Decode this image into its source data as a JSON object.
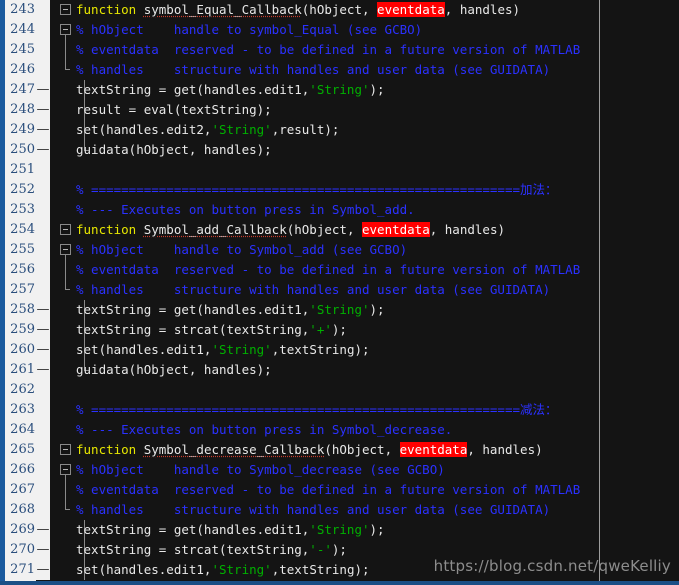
{
  "editor": {
    "title": "MATLAB Editor",
    "language": "MATLAB",
    "first_line": 243,
    "last_line": 271,
    "colors": {
      "background": "#141414",
      "gutter": "#f1f1f1",
      "linenumber": "#2b4f7d",
      "keyword": "#e7e700",
      "comment": "#2b31ff",
      "string": "#00b000",
      "plain": "#e8e8e8",
      "highlight": "#ff0000",
      "activity_strip": "#1a5a9e",
      "column_guide": "#9d9d9d"
    },
    "column_guide_column": 80
  },
  "watermark": {
    "text": "https://blog.csdn.net/qweKelliy"
  },
  "lines": [
    {
      "number": "243",
      "dash": "",
      "fold": "open",
      "bar": "none",
      "body": "none",
      "tokens": [
        {
          "t": "function ",
          "c": "kw"
        },
        {
          "t": "symbol_Equal_Callback",
          "c": "sq"
        },
        {
          "t": "(hObject, ",
          "c": "plain"
        },
        {
          "t": "eventdata",
          "c": "hl"
        },
        {
          "t": ", handles)",
          "c": "plain"
        }
      ]
    },
    {
      "number": "244",
      "dash": "",
      "fold": "open",
      "bar": "topstub",
      "body": "none",
      "tokens": [
        {
          "t": "% hObject    handle to symbol_Equal (see GCBO)",
          "c": "cmt"
        }
      ]
    },
    {
      "number": "245",
      "dash": "",
      "fold": "none",
      "bar": "full",
      "body": "none",
      "tokens": [
        {
          "t": "% eventdata  reserved - to be defined in a future version of MATLAB",
          "c": "cmt"
        }
      ]
    },
    {
      "number": "246",
      "dash": "",
      "fold": "none",
      "bar": "endtick",
      "body": "none",
      "tokens": [
        {
          "t": "% handles    structure with handles and user data (see GUIDATA)",
          "c": "cmt"
        }
      ]
    },
    {
      "number": "247",
      "dash": "—",
      "fold": "none",
      "bar": "none",
      "body": "full",
      "tokens": [
        {
          "t": "textString = get(handles.edit1,",
          "c": "plain"
        },
        {
          "t": "'String'",
          "c": "str"
        },
        {
          "t": ");",
          "c": "plain"
        }
      ]
    },
    {
      "number": "248",
      "dash": "—",
      "fold": "none",
      "bar": "none",
      "body": "full",
      "tokens": [
        {
          "t": "result = eval(textString);",
          "c": "plain"
        }
      ]
    },
    {
      "number": "249",
      "dash": "—",
      "fold": "none",
      "bar": "none",
      "body": "full",
      "tokens": [
        {
          "t": "set(handles.edit2,",
          "c": "plain"
        },
        {
          "t": "'String'",
          "c": "str"
        },
        {
          "t": ",result);",
          "c": "plain"
        }
      ]
    },
    {
      "number": "250",
      "dash": "—",
      "fold": "none",
      "bar": "none",
      "body": "endtick",
      "tokens": [
        {
          "t": "guidata(hObject, handles);",
          "c": "plain"
        }
      ]
    },
    {
      "number": "251",
      "dash": "",
      "fold": "none",
      "bar": "none",
      "body": "none",
      "tokens": []
    },
    {
      "number": "252",
      "dash": "",
      "fold": "none",
      "bar": "none",
      "body": "none",
      "tokens": [
        {
          "t": "% =========================================================加法：",
          "c": "cmt"
        }
      ]
    },
    {
      "number": "253",
      "dash": "",
      "fold": "none",
      "bar": "none",
      "body": "none",
      "tokens": [
        {
          "t": "% --- Executes on button press in Symbol_add.",
          "c": "cmt"
        }
      ]
    },
    {
      "number": "254",
      "dash": "",
      "fold": "open",
      "bar": "none",
      "body": "none",
      "tokens": [
        {
          "t": "function ",
          "c": "kw"
        },
        {
          "t": "Symbol_add_Callback",
          "c": "sq"
        },
        {
          "t": "(hObject, ",
          "c": "plain"
        },
        {
          "t": "eventdata",
          "c": "hl"
        },
        {
          "t": ", handles)",
          "c": "plain"
        }
      ]
    },
    {
      "number": "255",
      "dash": "",
      "fold": "open",
      "bar": "topstub",
      "body": "none",
      "tokens": [
        {
          "t": "% hObject    handle to Symbol_add (see GCBO)",
          "c": "cmt"
        }
      ]
    },
    {
      "number": "256",
      "dash": "",
      "fold": "none",
      "bar": "full",
      "body": "none",
      "tokens": [
        {
          "t": "% eventdata  reserved - to be defined in a future version of MATLAB",
          "c": "cmt"
        }
      ]
    },
    {
      "number": "257",
      "dash": "",
      "fold": "none",
      "bar": "endtick",
      "body": "none",
      "tokens": [
        {
          "t": "% handles    structure with handles and user data (see GUIDATA)",
          "c": "cmt"
        }
      ]
    },
    {
      "number": "258",
      "dash": "—",
      "fold": "none",
      "bar": "none",
      "body": "full",
      "tokens": [
        {
          "t": "textString = get(handles.edit1,",
          "c": "plain"
        },
        {
          "t": "'String'",
          "c": "str"
        },
        {
          "t": ");",
          "c": "plain"
        }
      ]
    },
    {
      "number": "259",
      "dash": "—",
      "fold": "none",
      "bar": "none",
      "body": "full",
      "tokens": [
        {
          "t": "textString = strcat(textString,",
          "c": "plain"
        },
        {
          "t": "'+'",
          "c": "str"
        },
        {
          "t": ");",
          "c": "plain"
        }
      ]
    },
    {
      "number": "260",
      "dash": "—",
      "fold": "none",
      "bar": "none",
      "body": "full",
      "tokens": [
        {
          "t": "set(handles.edit1,",
          "c": "plain"
        },
        {
          "t": "'String'",
          "c": "str"
        },
        {
          "t": ",textString);",
          "c": "plain"
        }
      ]
    },
    {
      "number": "261",
      "dash": "—",
      "fold": "none",
      "bar": "none",
      "body": "endtick",
      "tokens": [
        {
          "t": "guidata(hObject, handles);",
          "c": "plain"
        }
      ]
    },
    {
      "number": "262",
      "dash": "",
      "fold": "none",
      "bar": "none",
      "body": "none",
      "tokens": []
    },
    {
      "number": "263",
      "dash": "",
      "fold": "none",
      "bar": "none",
      "body": "none",
      "tokens": [
        {
          "t": "% =========================================================减法：",
          "c": "cmt"
        }
      ]
    },
    {
      "number": "264",
      "dash": "",
      "fold": "none",
      "bar": "none",
      "body": "none",
      "tokens": [
        {
          "t": "% --- Executes on button press in Symbol_decrease.",
          "c": "cmt"
        }
      ]
    },
    {
      "number": "265",
      "dash": "",
      "fold": "open",
      "bar": "none",
      "body": "none",
      "tokens": [
        {
          "t": "function ",
          "c": "kw"
        },
        {
          "t": "Symbol_decrease_Callback",
          "c": "sq"
        },
        {
          "t": "(hObject, ",
          "c": "plain"
        },
        {
          "t": "eventdata",
          "c": "hl"
        },
        {
          "t": ", handles)",
          "c": "plain"
        }
      ]
    },
    {
      "number": "266",
      "dash": "",
      "fold": "open",
      "bar": "topstub",
      "body": "none",
      "tokens": [
        {
          "t": "% hObject    handle to Symbol_decrease (see GCBO)",
          "c": "cmt"
        }
      ]
    },
    {
      "number": "267",
      "dash": "",
      "fold": "none",
      "bar": "full",
      "body": "none",
      "tokens": [
        {
          "t": "% eventdata  reserved - to be defined in a future version of MATLAB",
          "c": "cmt"
        }
      ]
    },
    {
      "number": "268",
      "dash": "",
      "fold": "none",
      "bar": "endtick",
      "body": "none",
      "tokens": [
        {
          "t": "% handles    structure with handles and user data (see GUIDATA)",
          "c": "cmt"
        }
      ]
    },
    {
      "number": "269",
      "dash": "—",
      "fold": "none",
      "bar": "none",
      "body": "full",
      "tokens": [
        {
          "t": "textString = get(handles.edit1,",
          "c": "plain"
        },
        {
          "t": "'String'",
          "c": "str"
        },
        {
          "t": ");",
          "c": "plain"
        }
      ]
    },
    {
      "number": "270",
      "dash": "—",
      "fold": "none",
      "bar": "none",
      "body": "full",
      "tokens": [
        {
          "t": "textString = strcat(textString,",
          "c": "plain"
        },
        {
          "t": "'-'",
          "c": "str"
        },
        {
          "t": ");",
          "c": "plain"
        }
      ]
    },
    {
      "number": "271",
      "dash": "—",
      "fold": "none",
      "bar": "none",
      "body": "full",
      "tokens": [
        {
          "t": "set(handles.edit1,",
          "c": "plain"
        },
        {
          "t": "'String'",
          "c": "str"
        },
        {
          "t": ",textString);",
          "c": "plain"
        }
      ]
    }
  ]
}
